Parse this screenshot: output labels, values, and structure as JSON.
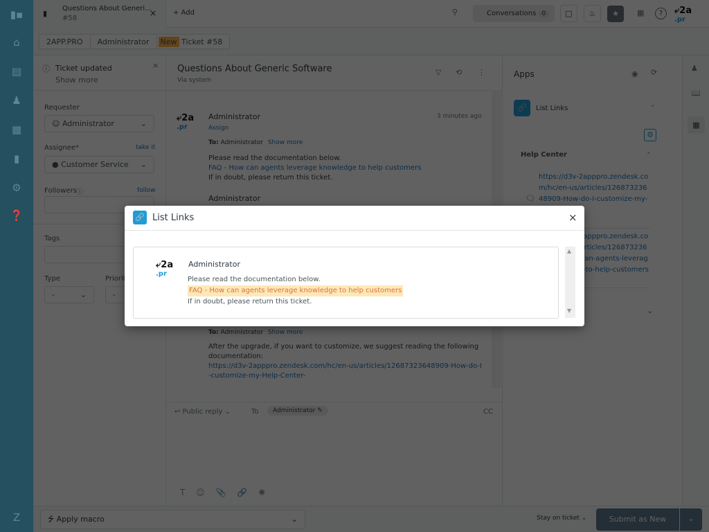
{
  "topbar": {
    "tab_title": "Questions About Generi...",
    "tab_sub": "#58",
    "add_label": "Add",
    "conversations_label": "Conversations",
    "conversations_count": "0",
    "brand_logo": "2a.pr"
  },
  "breadcrumb": [
    "2APP.PRO",
    "Administrator"
  ],
  "breadcrumb_badge": "New",
  "breadcrumb_ticket": "Ticket #58",
  "left": {
    "notice_title": "Ticket updated",
    "notice_link": "Show more",
    "requester_label": "Requester",
    "requester_value": "Administrator",
    "assignee_label": "Assignee*",
    "take_it": "take it",
    "assignee_value": "Customer Service",
    "followers_label": "Followers",
    "follow": "follow",
    "tags_label": "Tags",
    "type_label": "Type",
    "type_value": "-",
    "priority_label": "Priority",
    "priority_value": "-"
  },
  "conversation": {
    "title": "Questions About Generic Software",
    "via": "Via system",
    "messages": [
      {
        "author": "Administrator",
        "assign": "Assign",
        "time": "3 minutes ago",
        "to_label": "To:",
        "to": "Administrator",
        "show_more": "Show more",
        "line1": "Please read the documentation below.",
        "link": "FAQ - How can agents leverage knowledge to help customers",
        "line2": "If in doubt, please return this ticket."
      },
      {
        "author": "Administrator",
        "to_label": "To:",
        "to": "Administrator",
        "show_more": "Show more",
        "line1": "After the upgrade, if you want to customize, we suggest reading the following documentation:",
        "link": "https://d3v-2apppro.zendesk.com/hc/en-us/articles/12687323648909-How-do-I-customize-my-Help-Center-"
      }
    ]
  },
  "composer": {
    "reply_type": "Public reply",
    "to_label": "To",
    "recipient": "Administrator",
    "cc": "CC"
  },
  "apps": {
    "title": "Apps",
    "app_name": "List Links",
    "section": "Help Center",
    "links": [
      "https://d3v-2apppro.zendesk.com/hc/en-us/articles/12687323648909-How-do-I-customize-my-Help-Center-",
      "https://d3v-2apppro.zendesk.com/hc/en-us/articles/12687323661837-How-can-agents-leverage-knowledge-to-help-customers-"
    ]
  },
  "bottom": {
    "macro": "Apply macro",
    "stay": "Stay on ticket",
    "submit": "Submit as New"
  },
  "modal": {
    "title": "List Links",
    "author": "Administrator",
    "line1": "Please read the documentation below.",
    "highlight": "FAQ - How can agents leverage knowledge to help customers",
    "line2": "If in doubt, please return this ticket.",
    "highlight_color": "#fde9b8",
    "highlight_text_color": "#e0703a"
  }
}
